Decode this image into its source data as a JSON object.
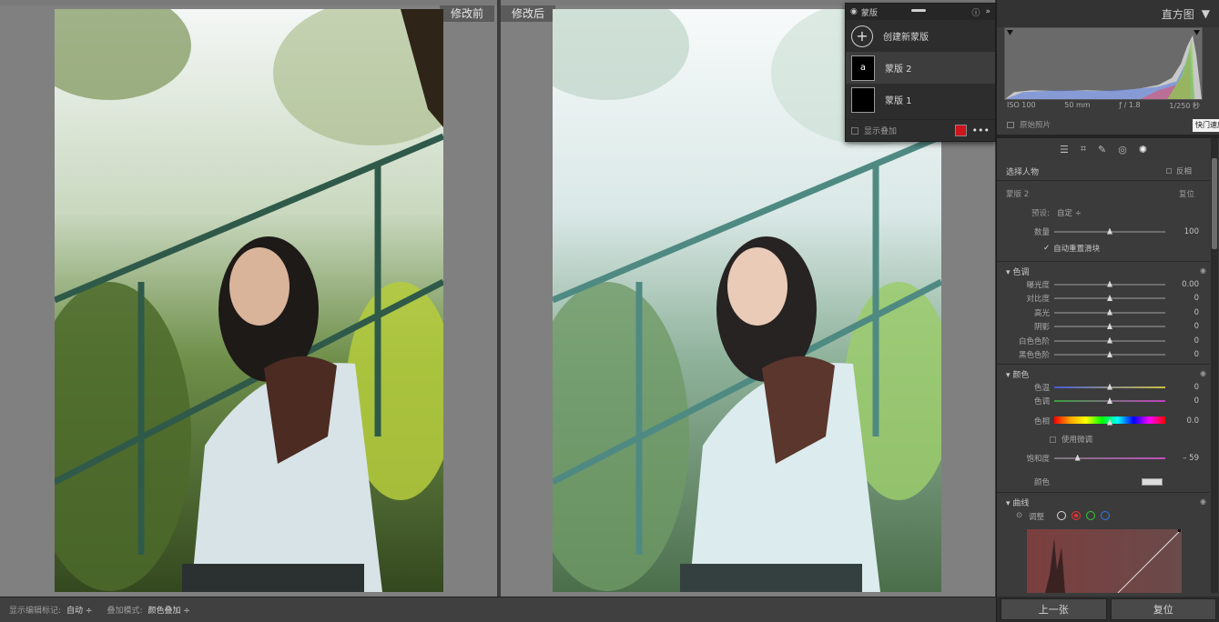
{
  "compare": {
    "before_label": "修改前",
    "after_label": "修改后"
  },
  "mask_panel": {
    "title": "蒙版",
    "create_label": "创建新蒙版",
    "masks": [
      {
        "name": "蒙版 2",
        "thumb_glyph": "a",
        "selected": true
      },
      {
        "name": "蒙版 1",
        "thumb_glyph": "",
        "selected": false
      }
    ],
    "show_overlay_label": "显示叠加",
    "overlay_color": "#d0141c",
    "more_icon": "more-icon"
  },
  "histogram": {
    "title": "直方图",
    "iso": "ISO 100",
    "focal": "50 mm",
    "aperture": "ƒ / 1.8",
    "shutter": "1/250 秒",
    "original_label": "原始照片",
    "tooltip": "快门速度"
  },
  "panel": {
    "select_subject": "选择人物",
    "invert_label": "反相",
    "mask_name": "蒙版 2",
    "reset_label": "复位",
    "preset_label": "预设:",
    "preset_value": "自定 ÷",
    "amount_label": "数量",
    "amount_value": "100",
    "amount_fraction": 0.5,
    "auto_reset_label": "自动重置滑块",
    "tone": {
      "title": "色调",
      "sliders": [
        {
          "label": "曝光度",
          "value": "0.00",
          "pos": 0.5
        },
        {
          "label": "对比度",
          "value": "0",
          "pos": 0.5
        },
        {
          "label": "高光",
          "value": "0",
          "pos": 0.5
        },
        {
          "label": "阴影",
          "value": "0",
          "pos": 0.5
        },
        {
          "label": "白色色阶",
          "value": "0",
          "pos": 0.5
        },
        {
          "label": "黑色色阶",
          "value": "0",
          "pos": 0.5
        }
      ]
    },
    "color": {
      "title": "颜色",
      "sliders": [
        {
          "label": "色温",
          "value": "0",
          "pos": 0.5
        },
        {
          "label": "色调",
          "value": "0",
          "pos": 0.5
        },
        {
          "label": "色相",
          "value": "0.0",
          "pos": 0.5
        }
      ],
      "fine_tune_label": "使用微调",
      "saturation_label": "饱和度",
      "saturation_value": "– 59",
      "saturation_pos": 0.21,
      "color_label": "颜色"
    },
    "curve": {
      "title": "曲线",
      "adjust_label": "调整",
      "channels": [
        "white",
        "red",
        "green",
        "blue"
      ]
    },
    "prev_label": "上一张",
    "reset_button_label": "复位"
  },
  "toolbar": {
    "show_marks_label": "显示编辑标记:",
    "show_marks_value": "自动 ÷",
    "overlay_mode_label": "叠加模式:",
    "overlay_mode_value": "颜色叠加 ÷"
  }
}
